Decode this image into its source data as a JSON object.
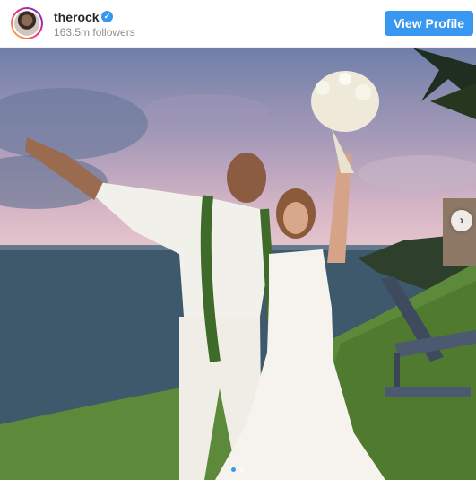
{
  "post": {
    "username": "therock",
    "verified": true,
    "followers": "163.5m followers",
    "view_profile_label": "View Profile"
  },
  "carousel": {
    "current_slide": 1,
    "total_slides": 2,
    "next_arrow": "›"
  },
  "icons": {
    "verified": "verified-badge-icon",
    "next": "chevron-right-icon"
  },
  "colors": {
    "accent": "#3897f0",
    "username": "#262626",
    "secondary_text": "#8e8e8e"
  }
}
